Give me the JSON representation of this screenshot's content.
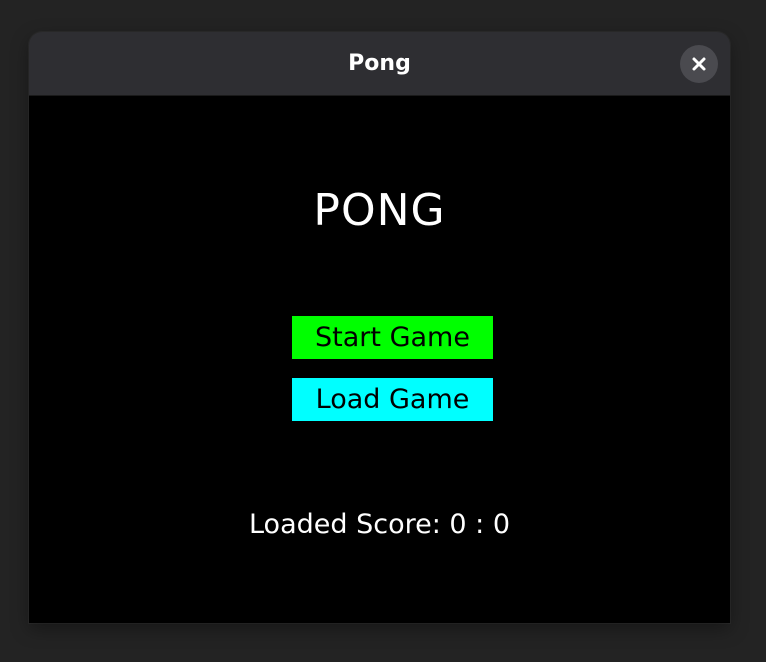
{
  "window": {
    "title": "Pong",
    "close_icon": "close-icon"
  },
  "game": {
    "title": "PONG",
    "start_label": "Start Game",
    "load_label": "Load Game",
    "score_text": "Loaded Score: 0 : 0"
  },
  "colors": {
    "start_button": "#00ff00",
    "load_button": "#00ffff",
    "canvas_background": "#000000",
    "titlebar_background": "#2e2e32"
  }
}
